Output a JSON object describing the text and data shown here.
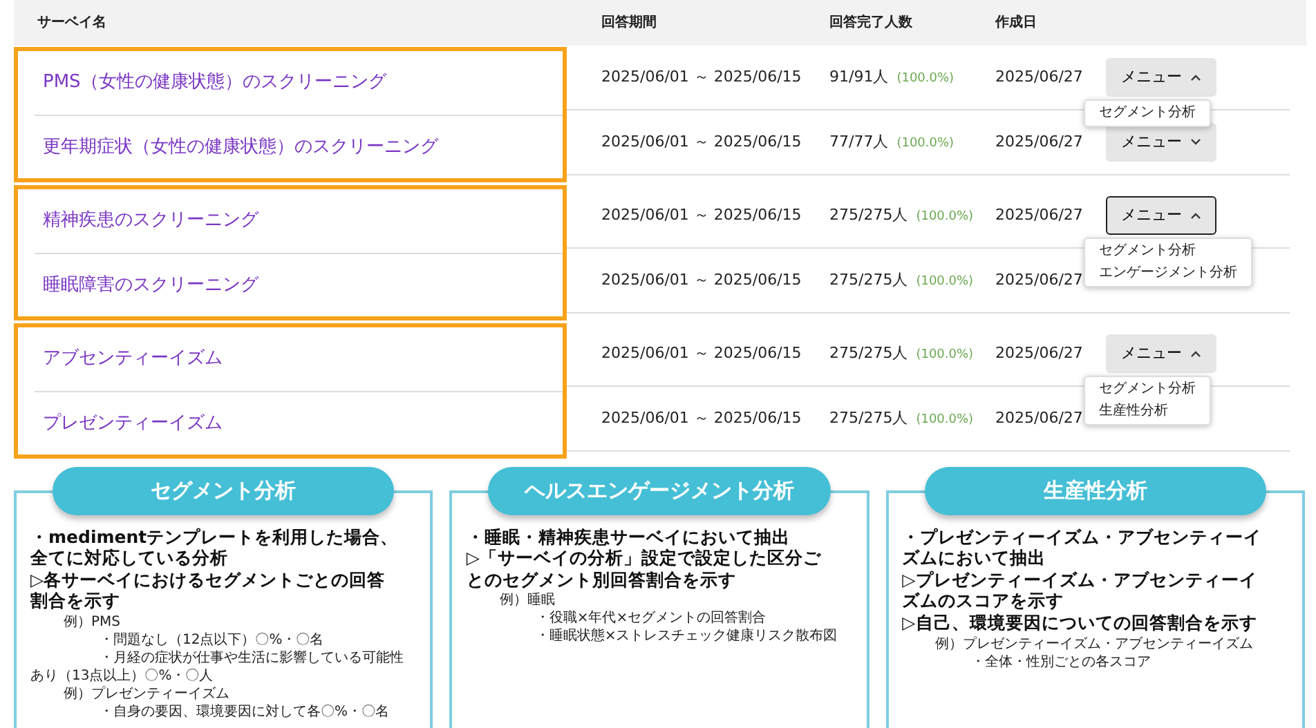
{
  "table": {
    "columns": [
      "サーベイ名",
      "回答期間",
      "回答完了人数",
      "作成日"
    ],
    "groups": [
      {
        "rows": [
          {
            "name": "PMS（女性の健康状態）のスクリーニング",
            "period": "2025/06/01 ～ 2025/06/15",
            "count": "91/91人",
            "rate": "(100.0%)",
            "date": "2025/06/27",
            "menu": {
              "label": "メニュー",
              "expanded": true,
              "focused": false,
              "items": [
                "セグメント分析"
              ]
            }
          },
          {
            "name": "更年期症状（女性の健康状態）のスクリーニング",
            "period": "2025/06/01 ～ 2025/06/15",
            "count": "77/77人",
            "rate": "(100.0%)",
            "date": "2025/06/27",
            "menu": {
              "label": "メニュー",
              "expanded": false,
              "focused": false
            }
          }
        ]
      },
      {
        "rows": [
          {
            "name": "精神疾患のスクリーニング",
            "period": "2025/06/01 ～ 2025/06/15",
            "count": "275/275人",
            "rate": "(100.0%)",
            "date": "2025/06/27",
            "menu": {
              "label": "メニュー",
              "expanded": true,
              "focused": true,
              "items": [
                "セグメント分析",
                "エンゲージメント分析"
              ]
            }
          },
          {
            "name": "睡眠障害のスクリーニング",
            "period": "2025/06/01 ～ 2025/06/15",
            "count": "275/275人",
            "rate": "(100.0%)",
            "date": "2025/06/27",
            "menu": null
          }
        ]
      },
      {
        "rows": [
          {
            "name": "アブセンティーイズム",
            "period": "2025/06/01 ～ 2025/06/15",
            "count": "275/275人",
            "rate": "(100.0%)",
            "date": "2025/06/27",
            "menu": {
              "label": "メニュー",
              "expanded": true,
              "focused": false,
              "items": [
                "セグメント分析",
                "生産性分析"
              ]
            }
          },
          {
            "name": "プレゼンティーイズム",
            "period": "2025/06/01 ～ 2025/06/15",
            "count": "275/275人",
            "rate": "(100.0%)",
            "date": "2025/06/27",
            "menu": null
          }
        ]
      }
    ]
  },
  "panels": [
    {
      "title": "セグメント分析",
      "lines": [
        {
          "kind": "point",
          "text": [
            "・medimentテンプレートを利用した場合、",
            "全てに対応している分析"
          ]
        },
        {
          "kind": "point",
          "text": [
            "▷各サーベイにおけるセグメントごとの回答",
            "割合を示す"
          ]
        },
        {
          "kind": "example",
          "text": [
            "例）PMS"
          ]
        },
        {
          "kind": "detail",
          "text": [
            "・問題なし（12点以下）〇%・〇名"
          ]
        },
        {
          "kind": "detail",
          "text": [
            "・月経の症状が仕事や生活に影響している可能性",
            "あり（13点以上）〇%・〇人"
          ]
        },
        {
          "kind": "example",
          "text": [
            "例）プレゼンティーイズム"
          ]
        },
        {
          "kind": "detail",
          "text": [
            "・自身の要因、環境要因に対して各〇%・〇名"
          ]
        }
      ]
    },
    {
      "title": "ヘルスエンゲージメント分析",
      "lines": [
        {
          "kind": "point",
          "text": [
            "・睡眠・精神疾患サーベイにおいて抽出"
          ]
        },
        {
          "kind": "point",
          "text": [
            "▷「サーベイの分析」設定で設定した区分ご",
            "とのセグメント別回答割合を示す"
          ]
        },
        {
          "kind": "example",
          "text": [
            "例）睡眠"
          ]
        },
        {
          "kind": "detail",
          "text": [
            "・役職×年代×セグメントの回答割合"
          ]
        },
        {
          "kind": "detail",
          "text": [
            "・睡眠状態×ストレスチェック健康リスク散布図"
          ]
        }
      ]
    },
    {
      "title": "生産性分析",
      "lines": [
        {
          "kind": "point",
          "text": [
            "・プレゼンティーイズム・アブセンティーイ",
            "ズムにおいて抽出"
          ]
        },
        {
          "kind": "point",
          "text": [
            "▷プレゼンティーイズム・アブセンティーイ",
            "ズムのスコアを示す"
          ]
        },
        {
          "kind": "point",
          "text": [
            "▷自己、環境要因についての回答割合を示す"
          ]
        },
        {
          "kind": "example",
          "text": [
            "例）プレゼンティーイズム・アブセンティーイズム"
          ]
        },
        {
          "kind": "detail",
          "text": [
            "・全体・性別ごとの各スコア"
          ]
        }
      ]
    }
  ]
}
